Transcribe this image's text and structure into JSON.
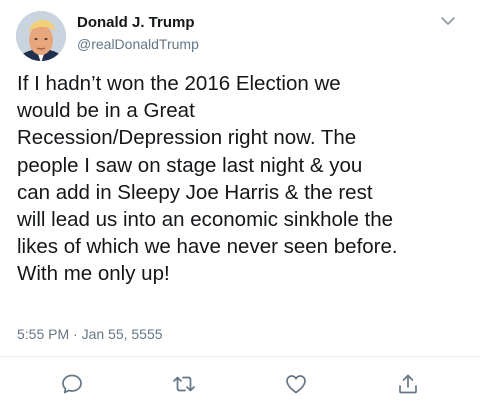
{
  "author": {
    "display_name": "Donald J. Trump",
    "handle": "@realDonaldTrump",
    "avatar_icon": "profile-photo"
  },
  "tweet": {
    "text": "If I hadn’t won the 2016 Election we\nwould be in a Great\nRecession/Depression right now. The\npeople I saw on stage last night & you\ncan add in Sleepy Joe Harris & the rest\nwill lead us into an economic sinkhole the\nlikes of which we have never seen before.\nWith me only up!",
    "timestamp": "5:55 PM · Jan 55, 5555"
  },
  "actions": [
    {
      "icon": "reply-icon"
    },
    {
      "icon": "retweet-icon"
    },
    {
      "icon": "like-icon"
    },
    {
      "icon": "share-icon"
    }
  ],
  "colors": {
    "text": "#14171a",
    "secondary": "#657786",
    "icon": "#657786",
    "divider": "#e6ecf0"
  }
}
